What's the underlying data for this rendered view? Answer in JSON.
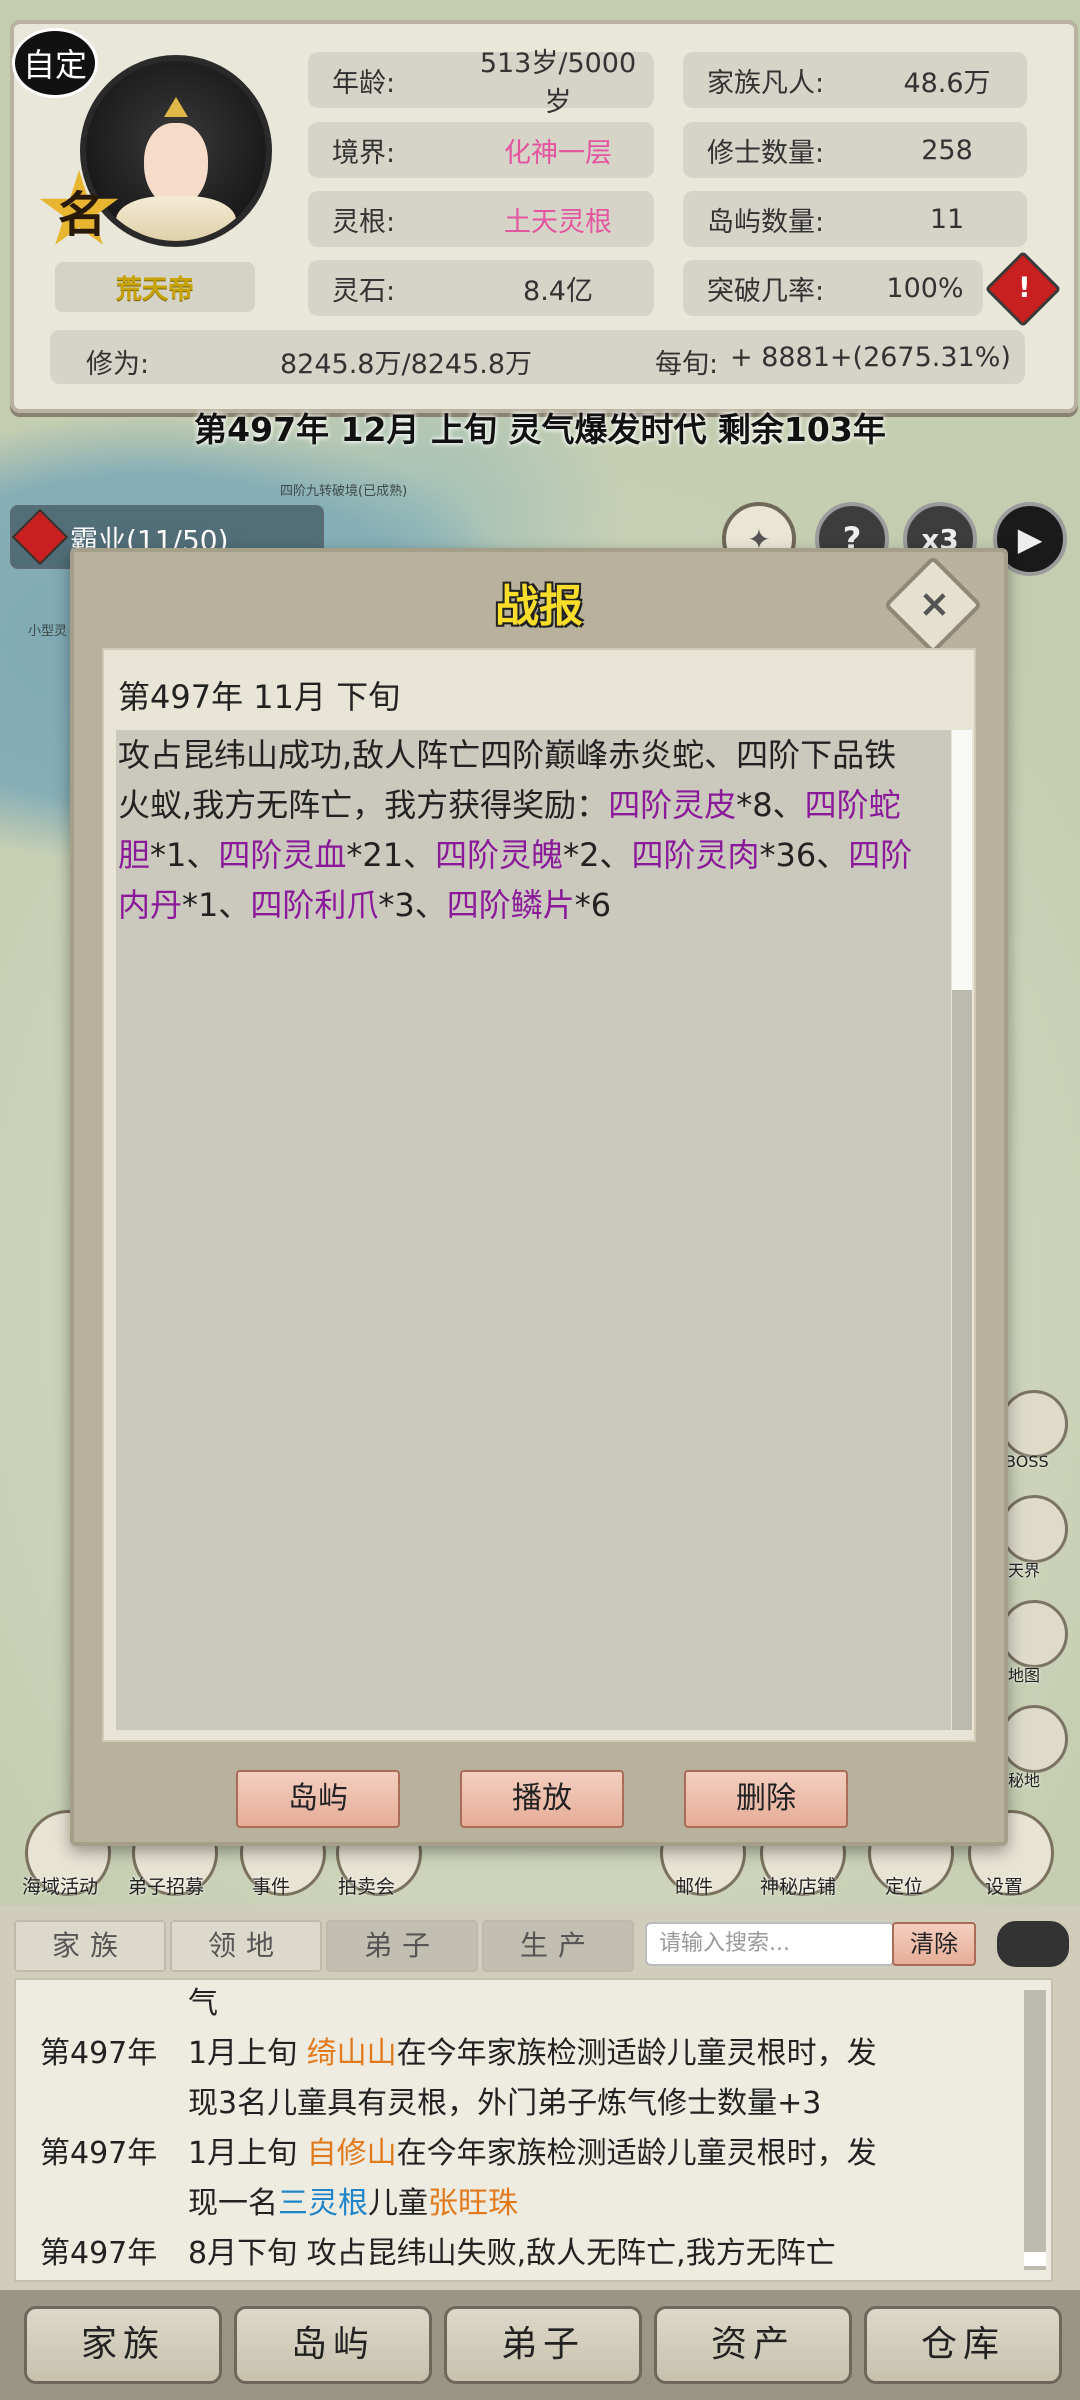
{
  "header": {
    "custom_badge": "自定",
    "name_char": "名",
    "title": "荒天帝",
    "stats_left": [
      {
        "key": "年龄:",
        "value": "513岁/5000岁"
      },
      {
        "key": "境界:",
        "value": "化神一层"
      },
      {
        "key": "灵根:",
        "value": "土天灵根"
      },
      {
        "key": "灵石:",
        "value": "8.4亿"
      }
    ],
    "stats_right": [
      {
        "key": "家族凡人:",
        "value": "48.6万"
      },
      {
        "key": "修士数量:",
        "value": "258"
      },
      {
        "key": "岛屿数量:",
        "value": "11"
      },
      {
        "key": "突破几率:",
        "value": "100%"
      }
    ],
    "cultivation_key": "修为:",
    "cultivation_value": "8245.8万/8245.8万",
    "per_period_key": "每旬:",
    "per_period_value": "+ 8881+(2675.31%)",
    "warning_icon": "!"
  },
  "date_banner": "第497年 12月 上旬  灵气爆发时代 剩余103年",
  "map": {
    "label_top": "四阶九转破境(已成熟)",
    "label_left": "小型灵",
    "side_labels": [
      "BOSS",
      "天界",
      "地图",
      "秘地"
    ]
  },
  "quest": {
    "label": "霸业(11/50)",
    "icon": "!"
  },
  "top_controls": {
    "help": "?",
    "speed": "x3",
    "play": "▶"
  },
  "modal": {
    "title": "战报",
    "close": "×",
    "report_date": "第497年 11月 下旬",
    "report_intro": "攻占昆纬山成功,敌人阵亡四阶巅峰赤炎蛇、四阶下品铁火蚁,我方无阵亡，我方获得奖励：",
    "rewards": [
      {
        "name": "四阶灵皮",
        "count": "*8"
      },
      {
        "name": "四阶蛇胆",
        "count": "*1"
      },
      {
        "name": "四阶灵血",
        "count": "*21"
      },
      {
        "name": "四阶灵魄",
        "count": "*2"
      },
      {
        "name": "四阶灵肉",
        "count": "*36"
      },
      {
        "name": "四阶内丹",
        "count": "*1"
      },
      {
        "name": "四阶利爪",
        "count": "*3"
      },
      {
        "name": "四阶鳞片",
        "count": "*6"
      }
    ],
    "separator": "、",
    "buttons": {
      "island": "岛屿",
      "play": "播放",
      "delete": "删除"
    }
  },
  "bottom_menu": [
    "海域活动",
    "弟子招募",
    "事件",
    "拍卖会",
    "邮件",
    "神秘店铺",
    "定位",
    "设置"
  ],
  "log": {
    "tabs": [
      "家族",
      "领地",
      "弟子",
      "生产"
    ],
    "search_placeholder": "请输入搜索...",
    "clear_label": "清除",
    "rows": [
      {
        "year": "",
        "text": "气"
      },
      {
        "year": "第497年",
        "text_a": "1月上旬 ",
        "place": "绮山山",
        "text_b": "在今年家族检测适龄儿童灵根时，发"
      },
      {
        "year": "",
        "text": "现3名儿童具有灵根，外门弟子炼气修士数量+3"
      },
      {
        "year": "第497年",
        "text_a": "1月上旬 ",
        "place": "自修山",
        "text_b": "在今年家族检测适龄儿童灵根时，发"
      },
      {
        "year": "",
        "text_a": "现一名",
        "root": "三灵根",
        "text_b": "儿童",
        "child": "张旺珠"
      },
      {
        "year": "第497年",
        "text": "8月下旬 攻占昆纬山失败,敌人无阵亡,我方无阵亡"
      }
    ]
  },
  "nav": [
    "家族",
    "岛屿",
    "弟子",
    "资产",
    "仓库"
  ]
}
